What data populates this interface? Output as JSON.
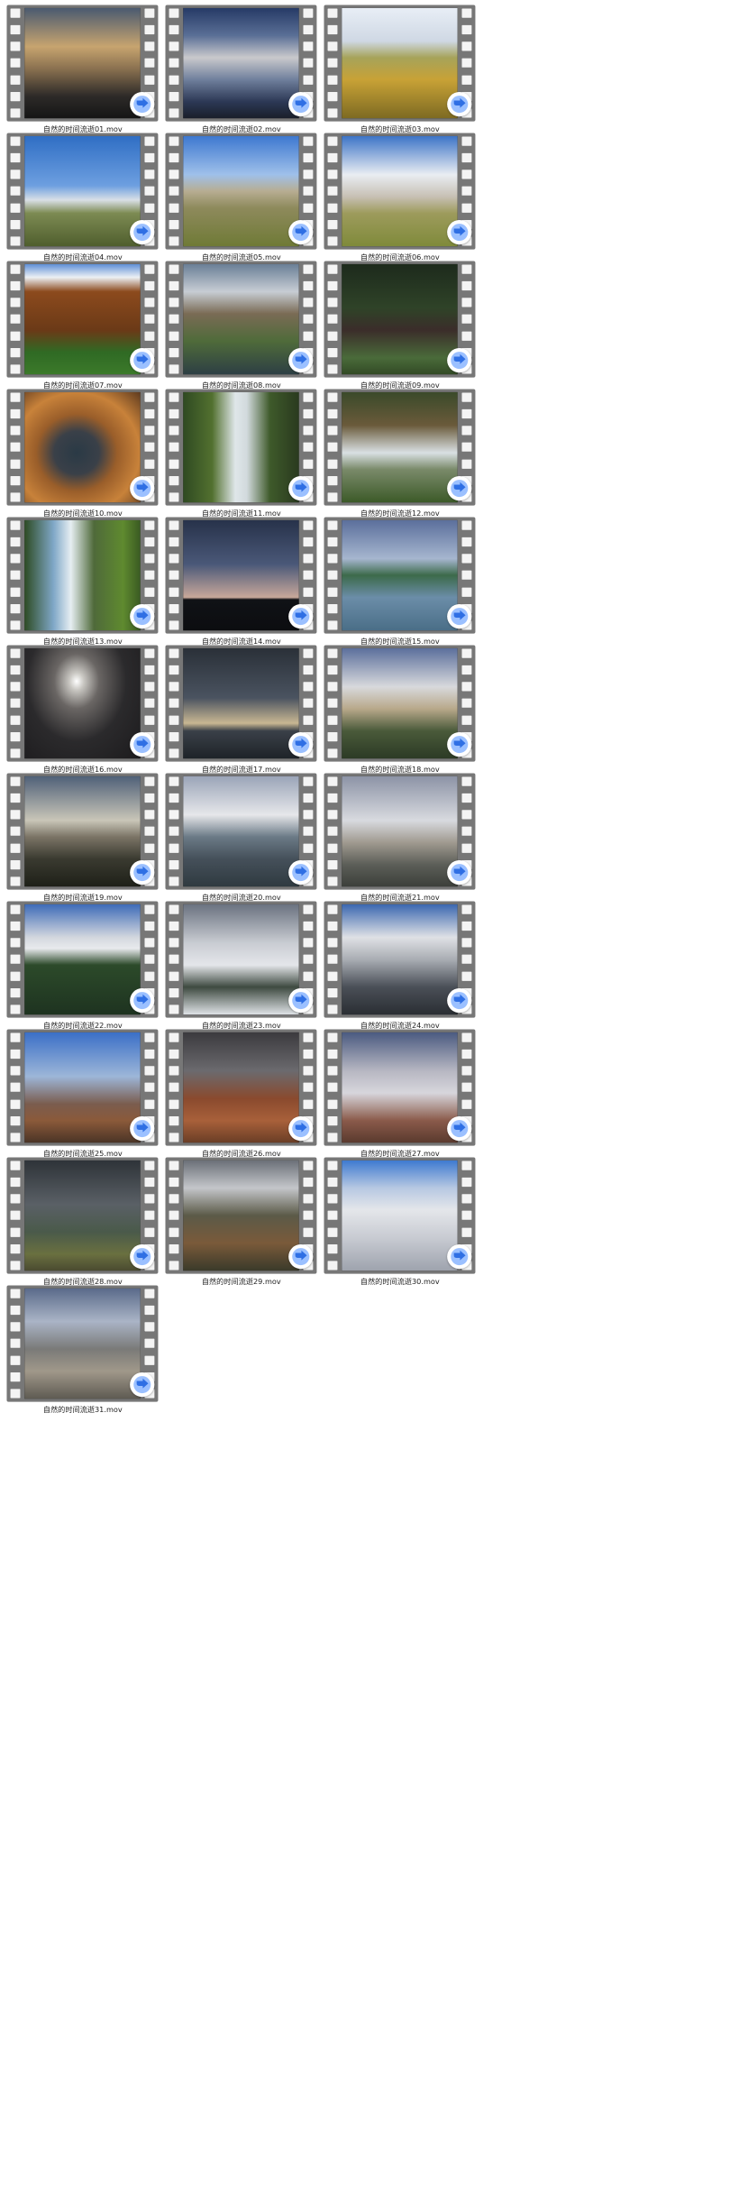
{
  "files": [
    {
      "name": "自然的时间流逝01.mov",
      "scene": "sunset-rays"
    },
    {
      "name": "自然的时间流逝02.mov",
      "scene": "sky-clouds"
    },
    {
      "name": "自然的时间流逝03.mov",
      "scene": "flower-meadow"
    },
    {
      "name": "自然的时间流逝04.mov",
      "scene": "blue-sky-plain"
    },
    {
      "name": "自然的时间流逝05.mov",
      "scene": "mesa-plain"
    },
    {
      "name": "自然的时间流逝06.mov",
      "scene": "big-cloud-plain"
    },
    {
      "name": "自然的时间流逝07.mov",
      "scene": "autumn-hill"
    },
    {
      "name": "自然的时间流逝08.mov",
      "scene": "mountain-lake"
    },
    {
      "name": "自然的时间流逝09.mov",
      "scene": "dark-forest-stream"
    },
    {
      "name": "自然的时间流逝10.mov",
      "scene": "autumn-leaves-pool"
    },
    {
      "name": "自然的时间流逝11.mov",
      "scene": "waterfall"
    },
    {
      "name": "自然的时间流逝12.mov",
      "scene": "forest-stream"
    },
    {
      "name": "自然的时间流逝13.mov",
      "scene": "tall-waterfall"
    },
    {
      "name": "自然的时间流逝14.mov",
      "scene": "palm-silhouette"
    },
    {
      "name": "自然的时间流逝15.mov",
      "scene": "coastline"
    },
    {
      "name": "自然的时间流逝16.mov",
      "scene": "moon-sea"
    },
    {
      "name": "自然的时间流逝17.mov",
      "scene": "storm-horizon"
    },
    {
      "name": "自然的时间流逝18.mov",
      "scene": "valley-clouds"
    },
    {
      "name": "自然的时间流逝19.mov",
      "scene": "valley-haze"
    },
    {
      "name": "自然的时间流逝20.mov",
      "scene": "valley-mist"
    },
    {
      "name": "自然的时间流逝21.mov",
      "scene": "cliff-fog"
    },
    {
      "name": "自然的时间流逝22.mov",
      "scene": "pine-snow-cloud"
    },
    {
      "name": "自然的时间流逝23.mov",
      "scene": "snowy-trees"
    },
    {
      "name": "自然的时间流逝24.mov",
      "scene": "snow-valley-clouds"
    },
    {
      "name": "自然的时间流逝25.mov",
      "scene": "desert-butte-blue"
    },
    {
      "name": "自然的时间流逝26.mov",
      "scene": "desert-butte-storm"
    },
    {
      "name": "自然的时间流逝27.mov",
      "scene": "butte-fog"
    },
    {
      "name": "自然的时间流逝28.mov",
      "scene": "desert-storm-plain"
    },
    {
      "name": "自然的时间流逝29.mov",
      "scene": "canyon-storm"
    },
    {
      "name": "自然的时间流逝30.mov",
      "scene": "cloud-sea"
    },
    {
      "name": "自然的时间流逝31.mov",
      "scene": "city-skyline"
    }
  ],
  "icons": {
    "frame": "film-strip-icon",
    "overlay": "play-arrow-badge-icon"
  },
  "colors": {
    "film": "#777777",
    "badge_blue": "#2f6fe4",
    "badge_light": "#9bc0ff",
    "label": "#222222"
  }
}
